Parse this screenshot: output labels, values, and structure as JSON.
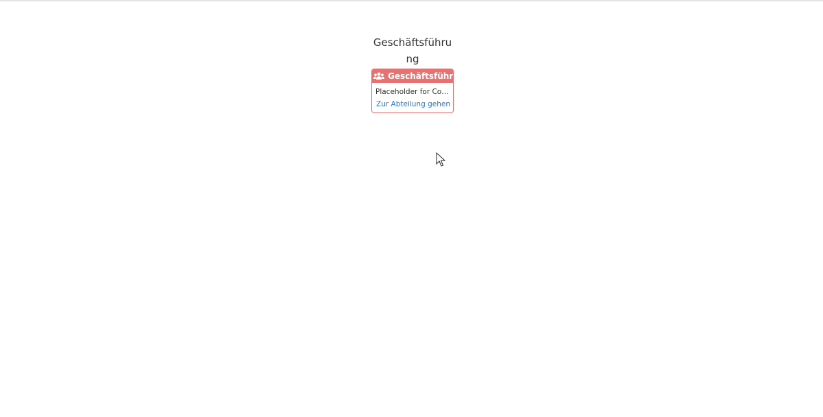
{
  "department": {
    "title": "Geschäftsführung",
    "card": {
      "header_icon": "users-icon",
      "header_label": "Geschäftsführer",
      "content": "Placeholder for Content",
      "link_label": "Zur Abteilung gehen"
    }
  },
  "colors": {
    "card_accent": "#e57373",
    "link": "#2a76d2"
  }
}
